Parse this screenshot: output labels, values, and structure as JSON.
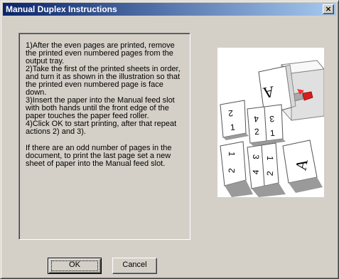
{
  "window": {
    "title": "Manual Duplex Instructions",
    "close_symbol": "×"
  },
  "instructions": {
    "steps": "1)After the even pages are printed, remove the printed even numbered pages from the output tray.\n2)Take the first of the printed sheets in order, and turn it as shown in the illustration so that the printed even numbered page is face down.\n3)Insert the paper into the Manual feed slot with both hands until the front edge of the paper touches the paper feed roller.\n4)Click OK to start printing, after that repeat actions 2) and 3).",
    "note": "If there are an odd number of pages in the document, to print the last page set a new sheet of paper into the Manual feed slot."
  },
  "illustration": {
    "page_labels": [
      "2",
      "1",
      "4",
      "3",
      "2",
      "1",
      "A",
      "1",
      "2",
      "3",
      "4",
      "1",
      "2",
      "A"
    ]
  },
  "buttons": {
    "ok_label": "OK",
    "cancel_label": "Cancel"
  },
  "colors": {
    "title_start": "#0a246a",
    "title_end": "#a6caf0",
    "face": "#d4d0c8",
    "printer_arrow": "#e02020"
  }
}
